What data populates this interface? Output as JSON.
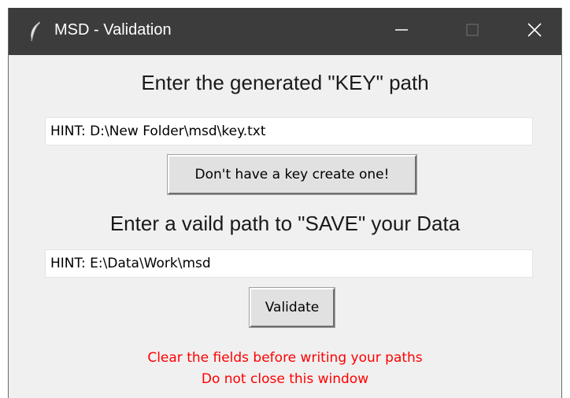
{
  "window": {
    "title": "MSD - Validation",
    "icon": "feather-icon"
  },
  "window_controls": {
    "minimize_icon": "minimize-icon",
    "maximize_icon": "maximize-icon",
    "close_icon": "close-icon"
  },
  "key_section": {
    "heading": "Enter the generated \"KEY\" path",
    "input_value": "HINT: D:\\New Folder\\msd\\key.txt",
    "create_button_label": "Don't have a key create one!"
  },
  "save_section": {
    "heading": "Enter a vaild path to \"SAVE\" your Data",
    "input_value": "HINT: E:\\Data\\Work\\msd",
    "validate_button_label": "Validate"
  },
  "warnings": {
    "line1": "Clear the fields before writing your paths",
    "line2": "Do not close this window",
    "color": "#ff0000"
  },
  "colors": {
    "titlebar": "#3c3c3c",
    "window_bg": "#f0f0f0",
    "button_bg": "#e1e1e1"
  }
}
